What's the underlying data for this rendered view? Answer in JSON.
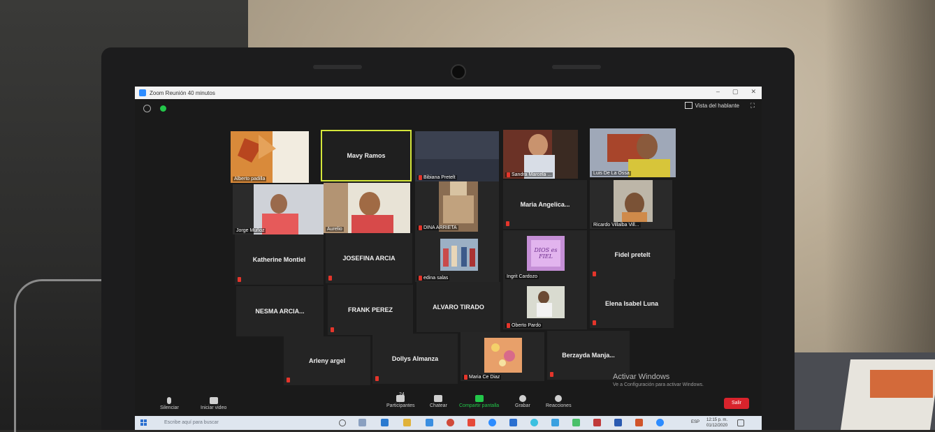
{
  "window": {
    "title": "Zoom Reunión 40 minutos"
  },
  "header": {
    "speaker_view_label": "Vista del hablante"
  },
  "participants": [
    {
      "name": "Alberto padilla",
      "has_video": true,
      "muted": false,
      "active": false
    },
    {
      "name": "Mavy Ramos",
      "has_video": false,
      "muted": false,
      "active": true
    },
    {
      "name": "Bibiana Pretelt",
      "has_video": true,
      "muted": true,
      "active": false
    },
    {
      "name": "Sandra Marcela ...",
      "has_video": true,
      "muted": true,
      "active": false
    },
    {
      "name": "Luis De La Ossa",
      "has_video": true,
      "muted": false,
      "active": false
    },
    {
      "name": "Jorge Muñoz",
      "has_video": true,
      "muted": false,
      "active": false
    },
    {
      "name": "Aurelio",
      "has_video": true,
      "muted": false,
      "active": false
    },
    {
      "name": "DINA  ARRIETA",
      "has_video": true,
      "muted": true,
      "active": false
    },
    {
      "name": "Maria Angelica...",
      "has_video": false,
      "muted": true,
      "active": false
    },
    {
      "name": "Ricardo Villalba Vill...",
      "has_video": true,
      "muted": false,
      "active": false
    },
    {
      "name": "Katherine Montiel",
      "has_video": false,
      "muted": true,
      "active": false
    },
    {
      "name": "JOSEFINA ARCIA",
      "has_video": false,
      "muted": true,
      "active": false
    },
    {
      "name": "edina salas",
      "has_video": true,
      "muted": true,
      "active": false
    },
    {
      "name": "Ingrit Cardozo",
      "has_video": true,
      "muted": false,
      "active": false
    },
    {
      "name": "Fidel pretelt",
      "has_video": false,
      "muted": true,
      "active": false
    },
    {
      "name": "NESMA ARCIA...",
      "has_video": false,
      "muted": false,
      "active": false
    },
    {
      "name": "FRANK PEREZ",
      "has_video": false,
      "muted": true,
      "active": false
    },
    {
      "name": "ALVARO TIRADO",
      "has_video": false,
      "muted": false,
      "active": false
    },
    {
      "name": "Oberto Pardo",
      "has_video": true,
      "muted": true,
      "active": false
    },
    {
      "name": "Elena Isabel Luna",
      "has_video": false,
      "muted": true,
      "active": false
    },
    {
      "name": "Arleny argel",
      "has_video": false,
      "muted": true,
      "active": false
    },
    {
      "name": "Dollys Almanza",
      "has_video": false,
      "muted": true,
      "active": false
    },
    {
      "name": "Maria Ce Diaz",
      "has_video": true,
      "muted": true,
      "active": false
    },
    {
      "name": "Berzayda  Manja...",
      "has_video": false,
      "muted": true,
      "active": false
    }
  ],
  "photo_overlay_text": "DIOS es FIEL",
  "watermark": {
    "title": "Activar Windows",
    "subtitle": "Ve a Configuración para activar Windows."
  },
  "toolbar": {
    "mute": "Silenciar",
    "video": "Iniciar video",
    "participants": "Participantes",
    "participants_count": "24",
    "chat": "Chatear",
    "share": "Compartir pantalla",
    "record": "Grabar",
    "reactions": "Reacciones",
    "leave": "Salir"
  },
  "taskbar": {
    "search_placeholder": "Escribe aquí para buscar",
    "lang": "ESP",
    "time": "12:15 p. m.",
    "date": "01/12/2020"
  },
  "colors": {
    "zoom_blue": "#2d8cff",
    "active_border": "#d4e63a",
    "mute_red": "#e4352b",
    "share_green": "#23c74a",
    "leave_red": "#d9232c"
  }
}
